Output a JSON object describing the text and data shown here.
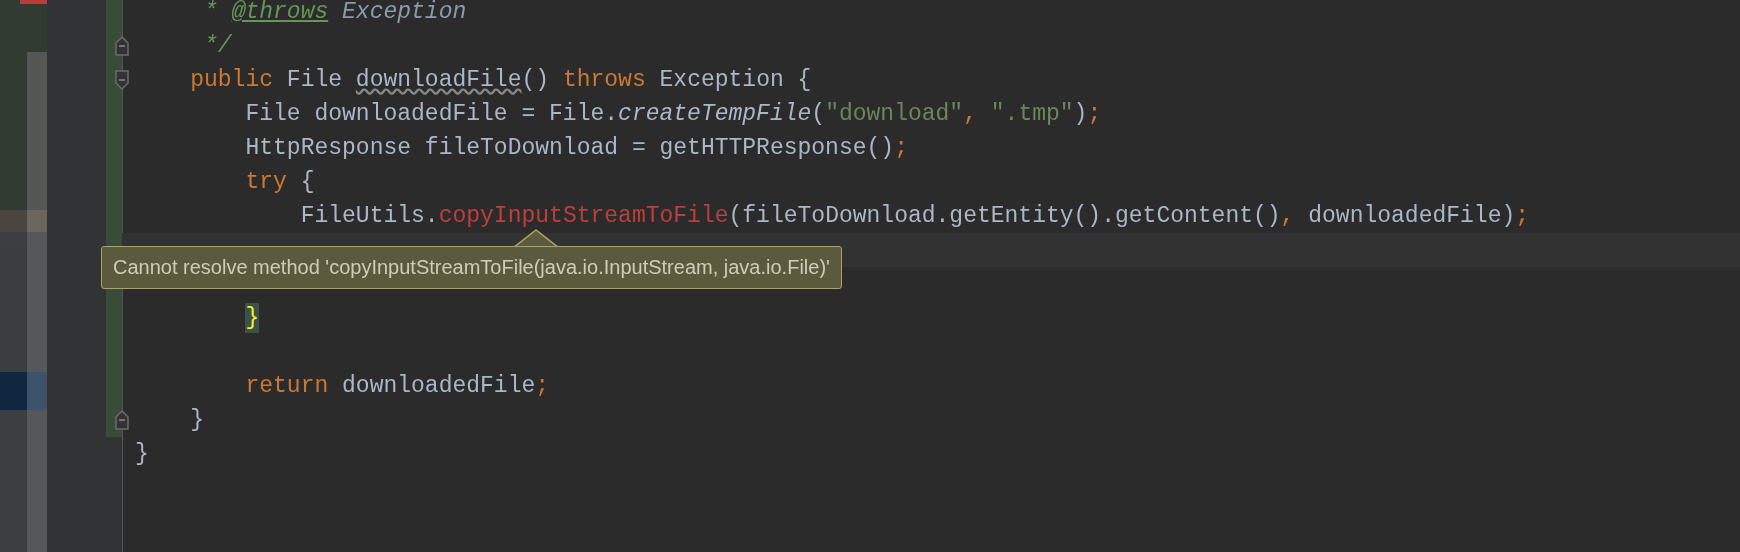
{
  "editor": {
    "lines": [
      {
        "kind": "code",
        "current": false,
        "changed": true,
        "tokens": [
          {
            "text": "     * ",
            "kind": "doc"
          },
          {
            "text": "@throws",
            "kind": "doctag"
          },
          {
            "text": " Exception",
            "kind": "docref"
          }
        ]
      },
      {
        "kind": "fold_end",
        "current": false,
        "changed": true,
        "tokens": [
          {
            "text": "     */",
            "kind": "doc"
          }
        ]
      },
      {
        "kind": "fold_start",
        "current": false,
        "changed": true,
        "tokens": [
          {
            "text": "    public ",
            "kind": "keyword"
          },
          {
            "text": "File ",
            "kind": "plain"
          },
          {
            "text": "downloadFile",
            "kind": "unused"
          },
          {
            "text": "() ",
            "kind": "plain"
          },
          {
            "text": "throws ",
            "kind": "keyword"
          },
          {
            "text": "Exception {",
            "kind": "plain"
          }
        ]
      },
      {
        "kind": "code",
        "current": false,
        "changed": true,
        "tokens": [
          {
            "text": "        File downloadedFile = File.",
            "kind": "plain"
          },
          {
            "text": "createTempFile",
            "kind": "static"
          },
          {
            "text": "(",
            "kind": "plain"
          },
          {
            "text": "\"download\"",
            "kind": "string"
          },
          {
            "text": ", ",
            "kind": "keyword"
          },
          {
            "text": "\".tmp\"",
            "kind": "string"
          },
          {
            "text": ")",
            "kind": "plain"
          },
          {
            "text": ";",
            "kind": "keyword"
          }
        ]
      },
      {
        "kind": "code",
        "current": false,
        "changed": true,
        "tokens": [
          {
            "text": "        HttpResponse fileToDownload = getHTTPResponse()",
            "kind": "plain"
          },
          {
            "text": ";",
            "kind": "keyword"
          }
        ]
      },
      {
        "kind": "code",
        "current": false,
        "changed": true,
        "tokens": [
          {
            "text": "        try ",
            "kind": "keyword"
          },
          {
            "text": "{",
            "kind": "plain"
          }
        ]
      },
      {
        "kind": "code",
        "current": false,
        "changed": true,
        "tokens": [
          {
            "text": "            FileUtils.",
            "kind": "plain"
          },
          {
            "text": "copyInputStreamToFile",
            "kind": "error"
          },
          {
            "text": "(fileToDownload.getEntity().getContent()",
            "kind": "plain"
          },
          {
            "text": ", ",
            "kind": "keyword"
          },
          {
            "text": "downloadedFile)",
            "kind": "plain"
          },
          {
            "text": ";",
            "kind": "keyword"
          }
        ]
      },
      {
        "kind": "code",
        "current": true,
        "changed": true
      },
      {
        "kind": "code",
        "current": false,
        "changed": true
      },
      {
        "kind": "code",
        "current": false,
        "changed": true,
        "tokens": [
          {
            "text": "        }",
            "kind": "match"
          }
        ]
      },
      {
        "kind": "code",
        "current": false,
        "changed": true
      },
      {
        "kind": "code",
        "current": false,
        "changed": true,
        "tokens": [
          {
            "text": "        return ",
            "kind": "keyword"
          },
          {
            "text": "downloadedFile",
            "kind": "plain"
          },
          {
            "text": ";",
            "kind": "keyword"
          }
        ]
      },
      {
        "kind": "fold_end",
        "current": false,
        "changed": true,
        "tokens": [
          {
            "text": "    }",
            "kind": "plain"
          }
        ]
      },
      {
        "kind": "code",
        "current": false,
        "changed": false,
        "tokens": [
          {
            "text": "}",
            "kind": "plain"
          }
        ]
      }
    ]
  },
  "tooltip": {
    "text": "Cannot resolve method 'copyInputStreamToFile(java.io.InputStream, java.io.File)'"
  }
}
